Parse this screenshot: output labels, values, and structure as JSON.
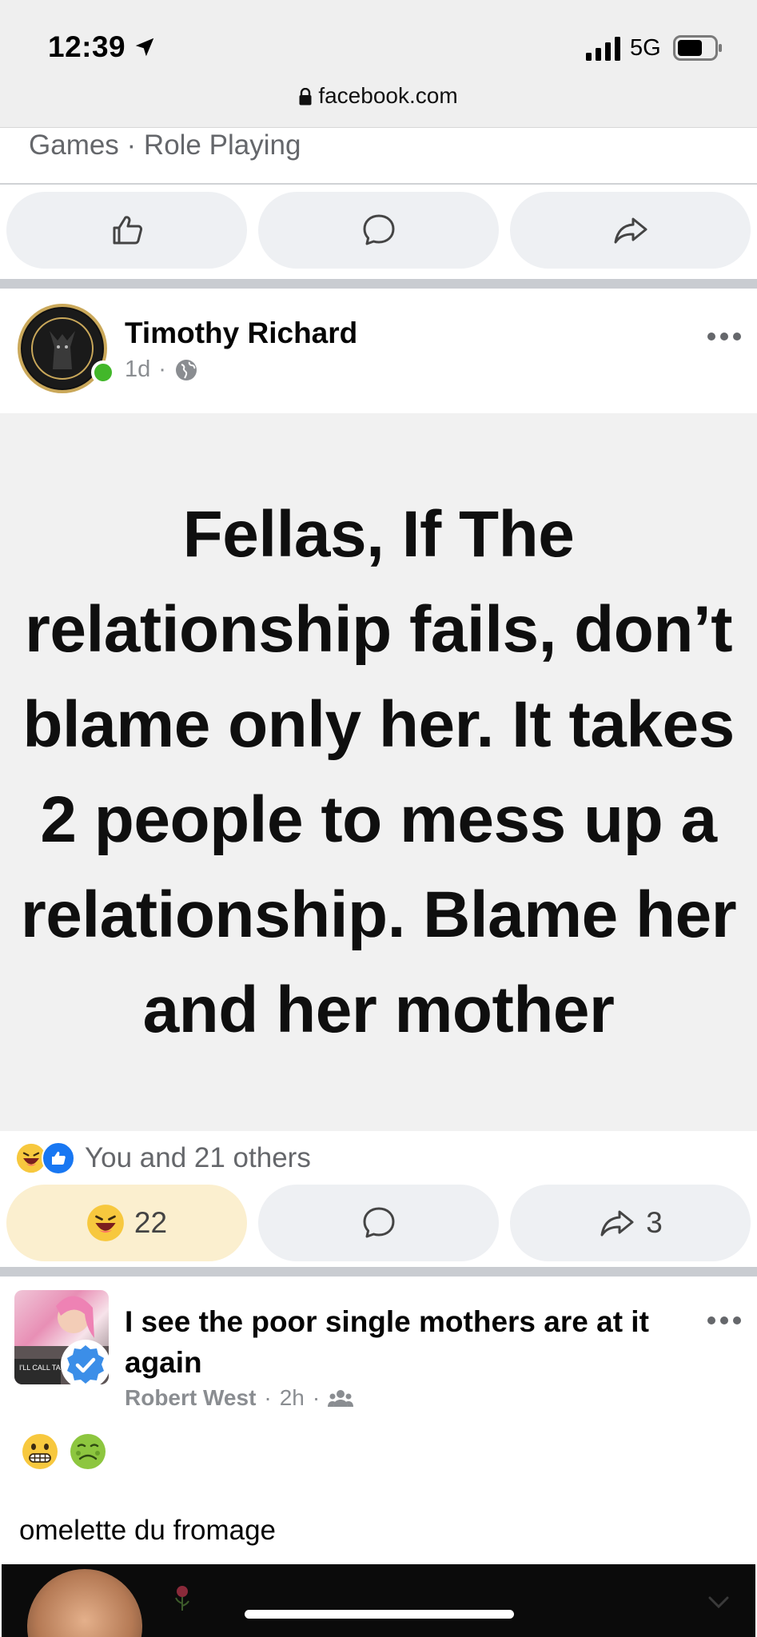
{
  "status": {
    "time": "12:39",
    "network": "5G",
    "url": "facebook.com"
  },
  "previous_post": {
    "category": "Games · Role Playing"
  },
  "post1": {
    "author": "Timothy Richard",
    "age": "1d",
    "separator": "·",
    "image_text": "Fellas, If The relationship fails, don’t blame only her. It takes 2 people to mess up a relationship. Blame her and her mother",
    "reactions_summary": "You and 21 others",
    "reaction_count": "22",
    "share_count": "3"
  },
  "post2": {
    "title": "I see the poor single mothers are at it again",
    "author": "Robert West",
    "age": "2h",
    "separator": "·",
    "avatar_caption": "I'LL CALL TA ASK MY OW",
    "body": "omelette du fromage"
  },
  "icons": {
    "like": "thumbs-up-icon",
    "comment": "comment-bubble-icon",
    "share": "share-arrow-icon",
    "more": "more-dots-icon",
    "globe": "globe-icon",
    "group": "group-icon",
    "verified": "verified-badge-icon"
  },
  "colors": {
    "accent": "#1877f2",
    "online": "#42b72a",
    "haha_active_bg": "#fbefcf",
    "button_bg": "#eef0f3"
  }
}
